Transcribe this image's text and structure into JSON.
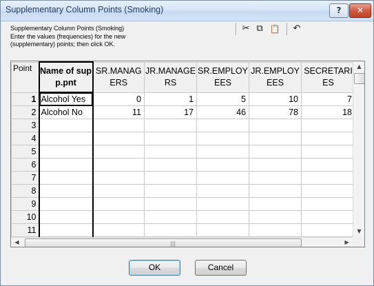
{
  "window": {
    "title": "Supplementary Column Points (Smoking)",
    "help_label": "?",
    "close_label": "✕"
  },
  "instructions": {
    "line1": "Supplementary Column Points (Smoking)",
    "line2": "Enter the values (frequencies) for the new",
    "line3": "(supplementary) points; then click OK."
  },
  "toolbar": {
    "cut_icon": "✂",
    "copy_icon": "⧉",
    "paste_icon": "📋",
    "undo_icon": "↶"
  },
  "grid": {
    "corner_label": "Point",
    "name_header": "Name of supp.pnt",
    "columns": [
      "SR.MANAGERS",
      "JR.MANAGERS",
      "SR.EMPLOYEES",
      "JR.EMPLOYEES",
      "SECRETARIES"
    ],
    "rows": [
      {
        "num": "1",
        "name": "Alcohol Yes",
        "values": [
          "0",
          "1",
          "5",
          "10",
          "7"
        ]
      },
      {
        "num": "2",
        "name": "Alcohol No",
        "values": [
          "11",
          "17",
          "46",
          "78",
          "18"
        ]
      },
      {
        "num": "3",
        "name": "",
        "values": [
          "",
          "",
          "",
          "",
          ""
        ]
      },
      {
        "num": "4",
        "name": "",
        "values": [
          "",
          "",
          "",
          "",
          ""
        ]
      },
      {
        "num": "5",
        "name": "",
        "values": [
          "",
          "",
          "",
          "",
          ""
        ]
      },
      {
        "num": "6",
        "name": "",
        "values": [
          "",
          "",
          "",
          "",
          ""
        ]
      },
      {
        "num": "7",
        "name": "",
        "values": [
          "",
          "",
          "",
          "",
          ""
        ]
      },
      {
        "num": "8",
        "name": "",
        "values": [
          "",
          "",
          "",
          "",
          ""
        ]
      },
      {
        "num": "9",
        "name": "",
        "values": [
          "",
          "",
          "",
          "",
          ""
        ]
      },
      {
        "num": "10",
        "name": "",
        "values": [
          "",
          "",
          "",
          "",
          ""
        ]
      },
      {
        "num": "11",
        "name": "",
        "values": [
          "",
          "",
          "",
          "",
          ""
        ]
      }
    ]
  },
  "buttons": {
    "ok": "OK",
    "cancel": "Cancel"
  }
}
